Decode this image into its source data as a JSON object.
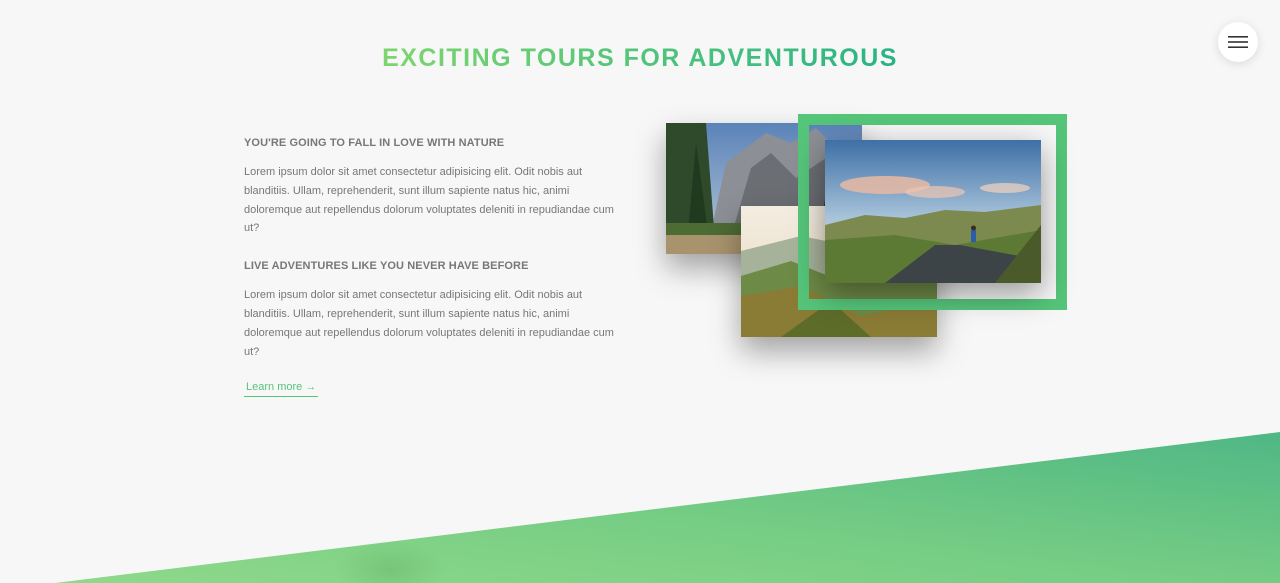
{
  "section": {
    "title": "EXCITING TOURS FOR ADVENTUROUS"
  },
  "content": {
    "heading_1": "YOU'RE GOING TO FALL IN LOVE WITH NATURE",
    "paragraph_1": "Lorem ipsum dolor sit amet consectetur adipisicing elit. Odit nobis aut blanditiis. Ullam, reprehenderit, sunt illum sapiente natus hic, animi doloremque aut repellendus dolorum voluptates deleniti in repudiandae cum ut?",
    "heading_2": "LIVE ADVENTURES LIKE YOU NEVER HAVE BEFORE",
    "paragraph_2": "Lorem ipsum dolor sit amet consectetur adipisicing elit. Odit nobis aut blanditiis. Ullam, reprehenderit, sunt illum sapiente natus hic, animi doloremque aut repellendus dolorum voluptates deleniti in repudiandae cum ut?",
    "link_label": "Learn more →"
  },
  "navigation": {
    "icon": "hamburger-menu-icon"
  },
  "colors": {
    "primary_light": "#7ed56f",
    "primary": "#55c57a",
    "primary_dark": "#28b485",
    "text": "#777777",
    "background": "#f7f7f7"
  }
}
